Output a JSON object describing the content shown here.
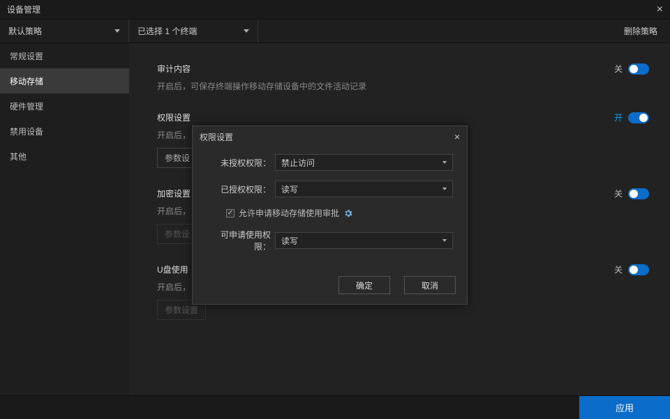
{
  "window": {
    "title": "设备管理"
  },
  "toolbar": {
    "policy_dropdown": "默认策略",
    "selection_dropdown": "已选择 1 个终端",
    "delete_label": "删除策略"
  },
  "sidebar": {
    "items": [
      {
        "label": "常规设置"
      },
      {
        "label": "移动存储"
      },
      {
        "label": "硬件管理"
      },
      {
        "label": "禁用设备"
      },
      {
        "label": "其他"
      }
    ],
    "active_index": 1
  },
  "sections": {
    "audit": {
      "title": "审计内容",
      "desc": "开启后，可保存终端操作移动存储设备中的文件活动记录",
      "state_label": "关"
    },
    "perm": {
      "title": "权限设置",
      "desc_prefix": "开启后，",
      "state_label": "开",
      "param_button": "参数设"
    },
    "encrypt": {
      "title": "加密设置",
      "desc_prefix": "开启后，",
      "state_label": "关",
      "param_button": "参数设"
    },
    "usb": {
      "title": "U盘使用",
      "desc_prefix": "开启后，",
      "state_label": "关",
      "param_button": "参数设置"
    }
  },
  "footer": {
    "apply": "应用"
  },
  "modal": {
    "title": "权限设置",
    "unauth_label": "未授权权限：",
    "unauth_value": "禁止访问",
    "auth_label": "已授权权限：",
    "auth_value": "读写",
    "checkbox_label": "允许申请移动存储使用审批",
    "checkbox_checked": true,
    "apply_label": "可申请使用权限：",
    "apply_value": "读写",
    "ok": "确定",
    "cancel": "取消"
  }
}
